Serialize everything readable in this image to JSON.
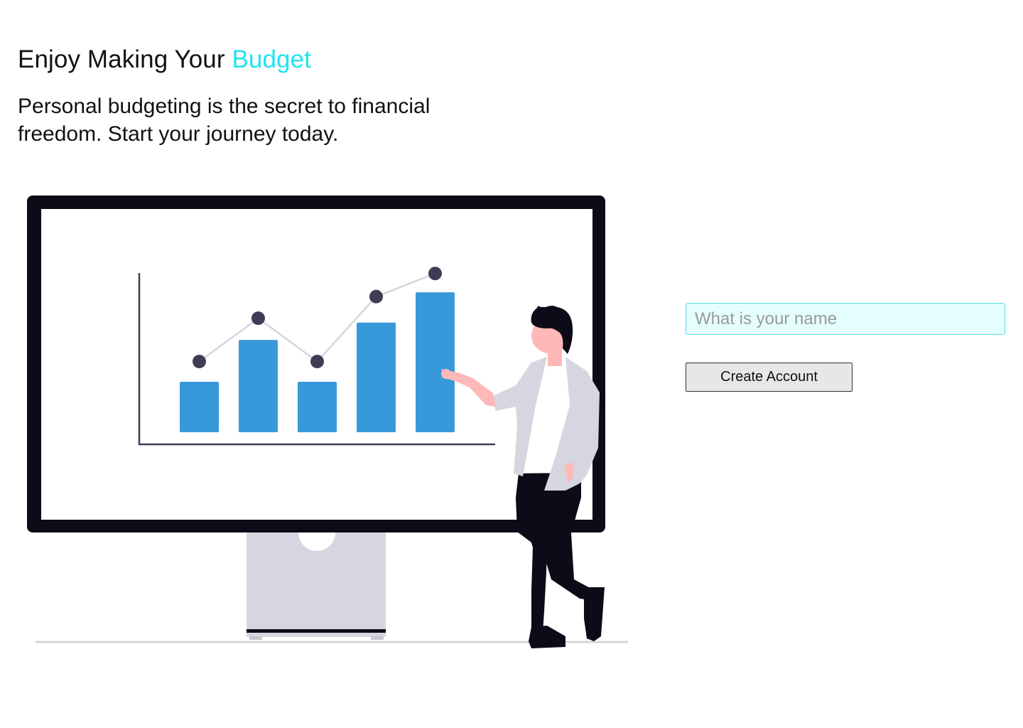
{
  "hero": {
    "title_prefix": "Enjoy Making Your ",
    "title_accent": "Budget",
    "subtitle": "Personal budgeting is the secret to financial freedom. Start your journey today."
  },
  "form": {
    "name_placeholder": "What is your name",
    "name_value": "",
    "create_label": "Create Account"
  },
  "colors": {
    "accent": "#1fe3f0",
    "input_bg": "#e4fdfd",
    "input_border": "#56dde7",
    "bar_blue": "#3899da",
    "marker_dark": "#3f3d56",
    "monitor_frame": "#0c0b17",
    "stand_gray": "#d6d6e0"
  },
  "illustration": {
    "name": "person-presenting-growth-chart",
    "bar_values": [
      3.5,
      6.4,
      3.5,
      7.6,
      9.7
    ],
    "line_points": [
      4.9,
      7.9,
      4.9,
      9.4,
      11.0
    ]
  }
}
